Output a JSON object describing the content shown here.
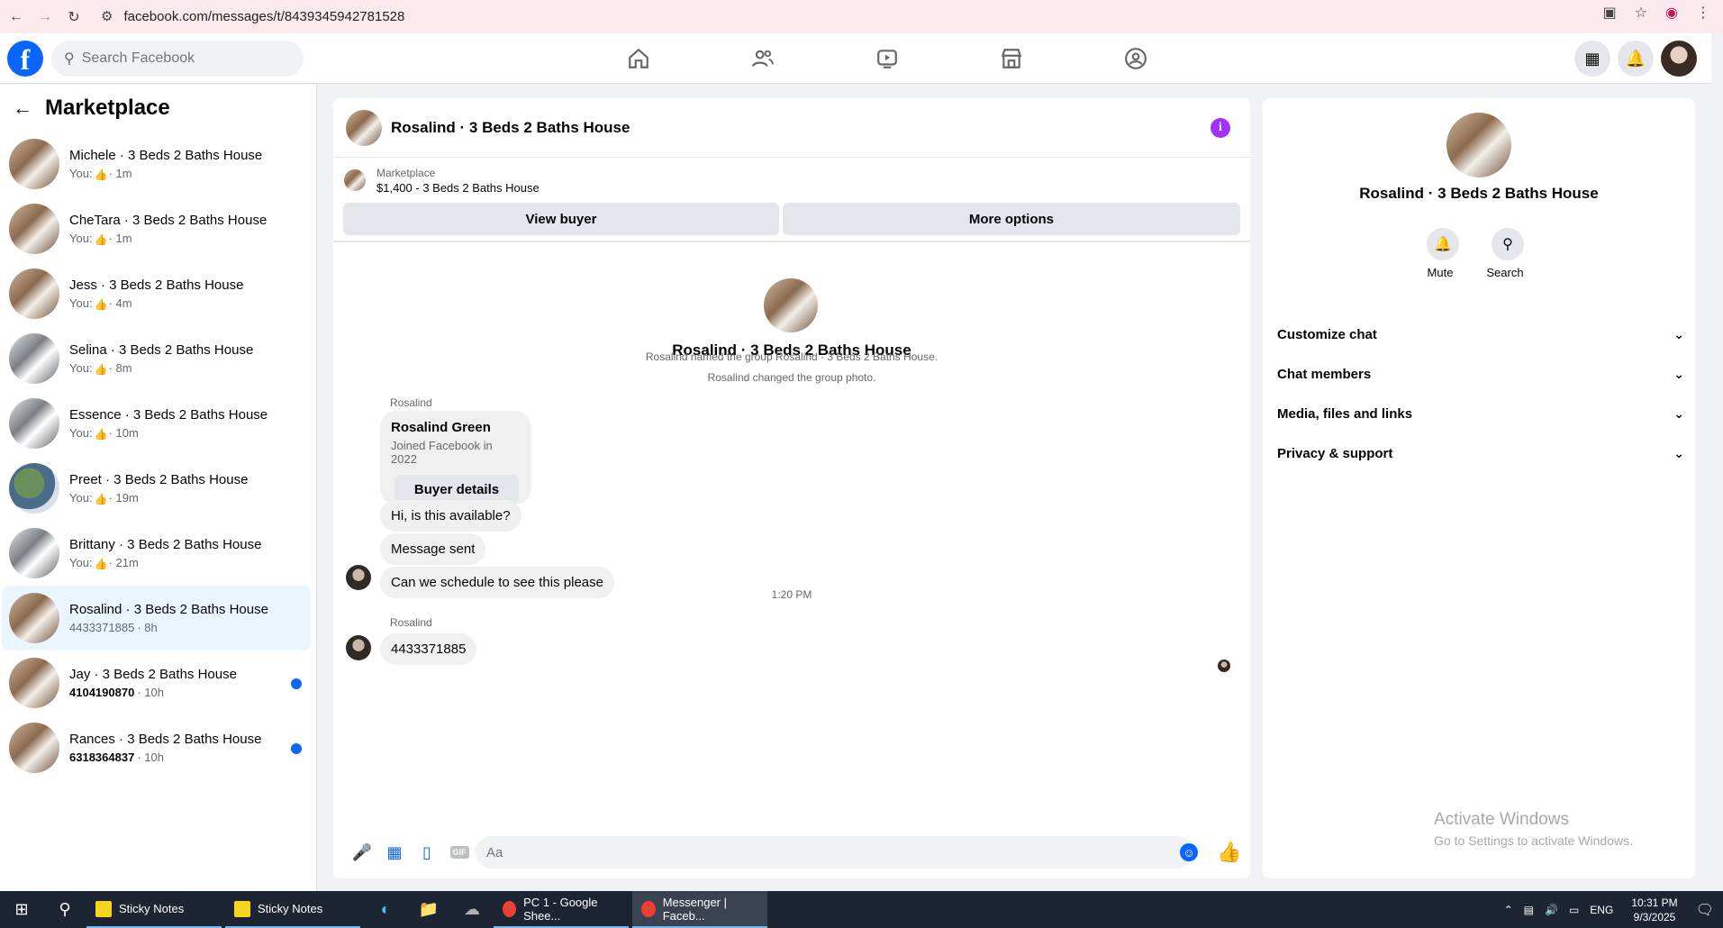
{
  "browser": {
    "url": "facebook.com/messages/t/8439345942781528"
  },
  "fb": {
    "search_placeholder": "Search Facebook"
  },
  "sidebar": {
    "title": "Marketplace",
    "conversations": [
      {
        "name": "Michele · 3 Beds 2 Baths House",
        "prefix": "You:",
        "time": "· 1m",
        "unread": false,
        "thumb": true
      },
      {
        "name": "CheTara · 3 Beds 2 Baths House",
        "prefix": "You:",
        "time": "· 1m",
        "unread": false,
        "thumb": true
      },
      {
        "name": "Jess · 3 Beds 2 Baths House",
        "prefix": "You:",
        "time": "· 4m",
        "unread": false,
        "thumb": true
      },
      {
        "name": "Selina · 3 Beds 2 Baths House",
        "prefix": "You:",
        "time": "· 8m",
        "unread": false,
        "thumb": true
      },
      {
        "name": "Essence · 3 Beds 2 Baths House",
        "prefix": "You:",
        "time": "· 10m",
        "unread": false,
        "thumb": true
      },
      {
        "name": "Preet · 3 Beds 2 Baths House",
        "prefix": "You:",
        "time": "· 19m",
        "unread": false,
        "thumb": true
      },
      {
        "name": "Brittany · 3 Beds 2 Baths House",
        "prefix": "You:",
        "time": "· 21m",
        "unread": false,
        "thumb": true
      },
      {
        "name": "Rosalind · 3 Beds 2 Baths House",
        "prefix": "4433371885",
        "time": "· 8h",
        "unread": false,
        "thumb": false
      },
      {
        "name": "Jay · 3 Beds 2 Baths House",
        "prefix": "4104190870",
        "time": "· 10h",
        "unread": true,
        "thumb": false
      },
      {
        "name": "Rances · 3 Beds 2 Baths House",
        "prefix": "6318364837",
        "time": "· 10h",
        "unread": true,
        "thumb": false
      }
    ]
  },
  "chat": {
    "title": "Rosalind · 3 Beds 2 Baths House",
    "marketplace_label": "Marketplace",
    "listing": "$1,400 - 3 Beds 2 Baths House",
    "view_buyer": "View buyer",
    "more_options": "More options",
    "center_title": "Rosalind · 3 Beds 2 Baths House",
    "system_1": "Rosalind named the group Rosalind · 3 Beds 2 Baths House.",
    "system_2": "Rosalind changed the group photo.",
    "sender_1": "Rosalind",
    "card_name": "Rosalind Green",
    "card_sub": "Joined Facebook in 2022",
    "card_button": "Buyer details",
    "msg_1": "Hi, is this available?",
    "msg_2": "Message sent",
    "msg_3": "Can we schedule to see this please",
    "timestamp": "1:20 PM",
    "sender_2": "Rosalind",
    "msg_4": "4433371885",
    "input_placeholder": "Aa",
    "gif_label": "GIF"
  },
  "details": {
    "title": "Rosalind · 3 Beds 2 Baths House",
    "mute": "Mute",
    "search": "Search",
    "sections": [
      "Customize chat",
      "Chat members",
      "Media, files and links",
      "Privacy & support"
    ],
    "watermark_1": "Activate Windows",
    "watermark_2": "Go to Settings to activate Windows."
  },
  "taskbar": {
    "apps": [
      {
        "label": "Sticky Notes",
        "color": "#f7d51d",
        "active": false
      },
      {
        "label": "Sticky Notes",
        "color": "#f7d51d",
        "active": false
      },
      {
        "label": "PC 1 - Google Shee...",
        "color": "#e94235",
        "active": false
      },
      {
        "label": "Messenger | Faceb...",
        "color": "#e94235",
        "active": true
      }
    ],
    "lang": "ENG",
    "time": "10:31 PM",
    "date": "9/3/2025"
  }
}
